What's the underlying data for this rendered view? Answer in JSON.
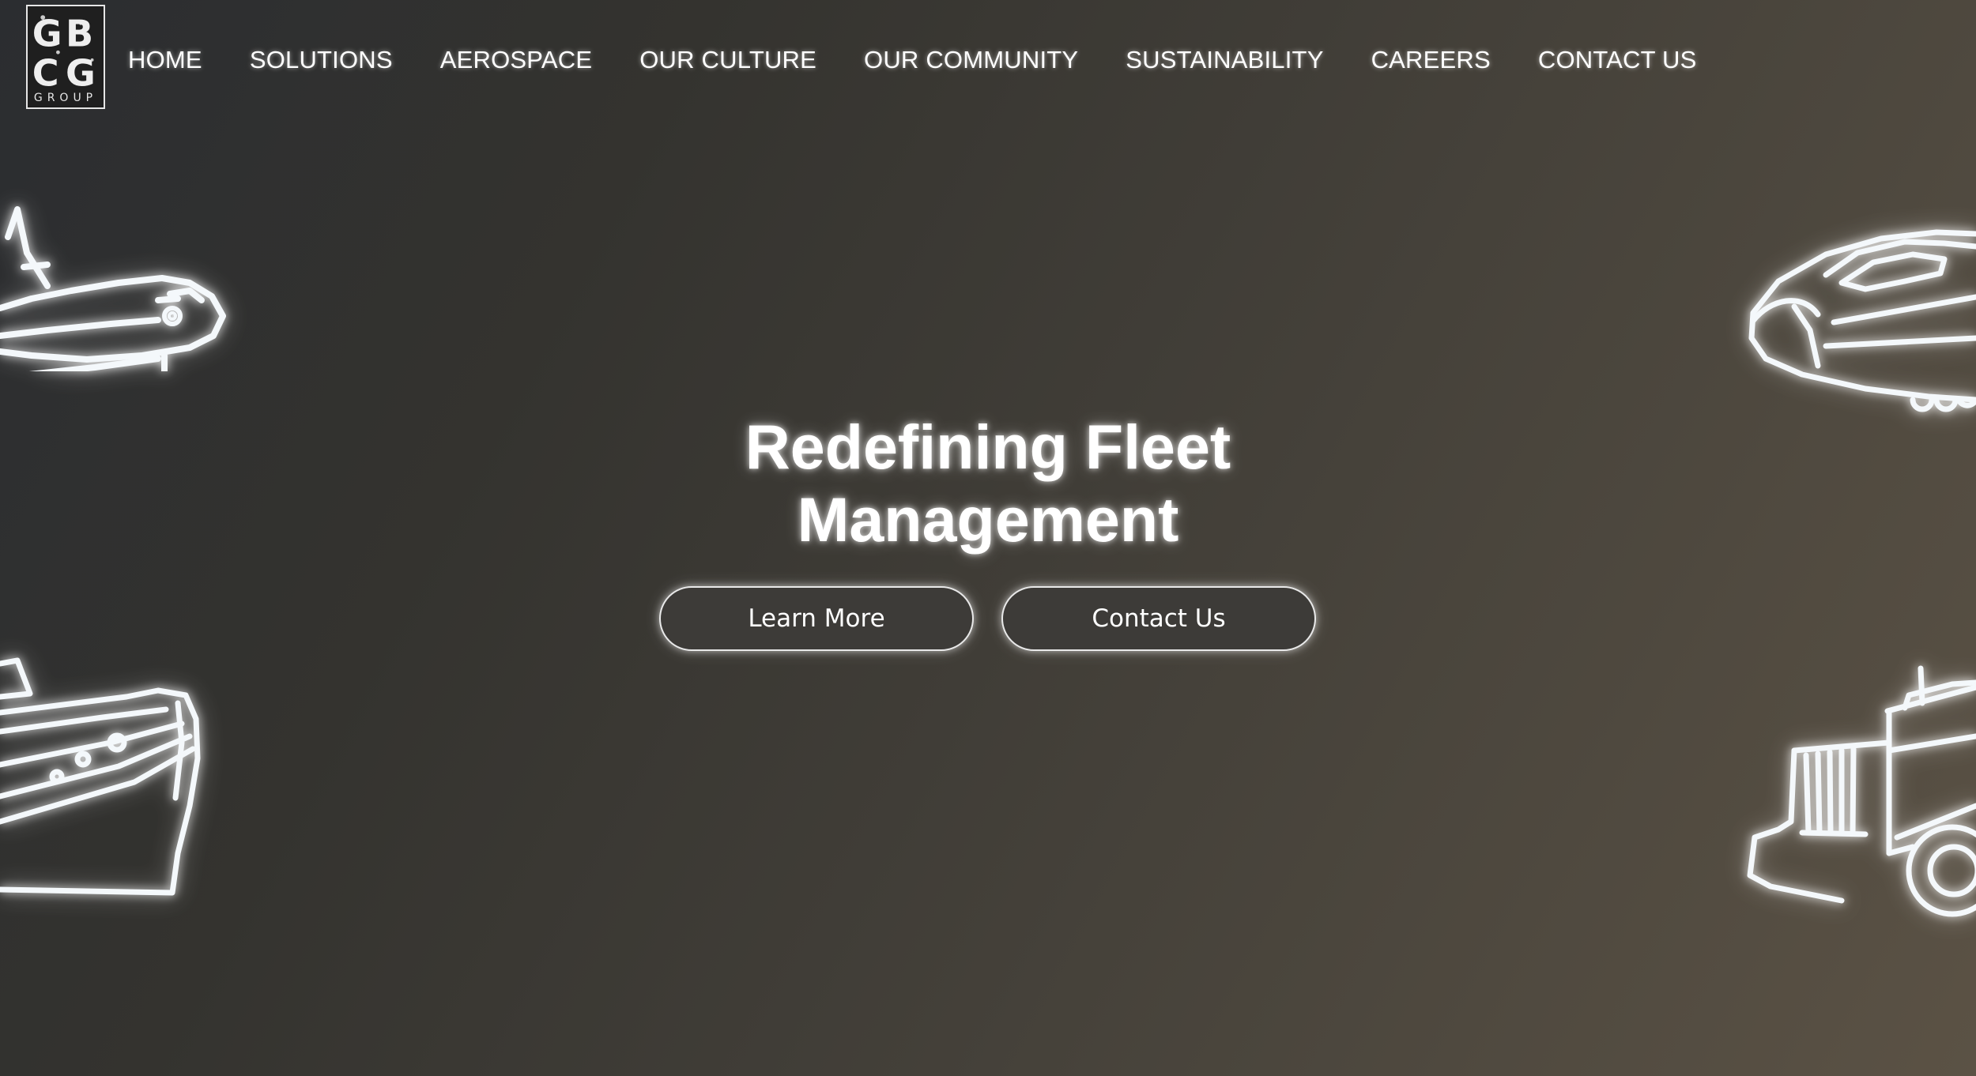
{
  "brand": {
    "logo_letters": "GBCG",
    "logo_word": "GROUP"
  },
  "nav": {
    "items": [
      {
        "label": "HOME",
        "name": "nav-home"
      },
      {
        "label": "SOLUTIONS",
        "name": "nav-solutions"
      },
      {
        "label": "AEROSPACE",
        "name": "nav-aerospace"
      },
      {
        "label": "OUR CULTURE",
        "name": "nav-our-culture"
      },
      {
        "label": "OUR COMMUNITY",
        "name": "nav-our-community"
      },
      {
        "label": "SUSTAINABILITY",
        "name": "nav-sustainability"
      },
      {
        "label": "CAREERS",
        "name": "nav-careers"
      },
      {
        "label": "CONTACT US",
        "name": "nav-contact-us"
      }
    ]
  },
  "hero": {
    "title_line1": "Redefining Fleet",
    "title_line2": "Management",
    "learn_more_label": "Learn More",
    "contact_label": "Contact Us"
  },
  "decorations": {
    "icons": [
      "space-shuttle-icon",
      "bullet-train-icon",
      "cruise-ship-icon",
      "semi-truck-icon"
    ]
  },
  "colors": {
    "background_start": "#2b2d30",
    "background_end": "#5b5245",
    "text": "#ffffff",
    "button_fill": "#3d3b38",
    "button_border": "#e9e9e9"
  }
}
